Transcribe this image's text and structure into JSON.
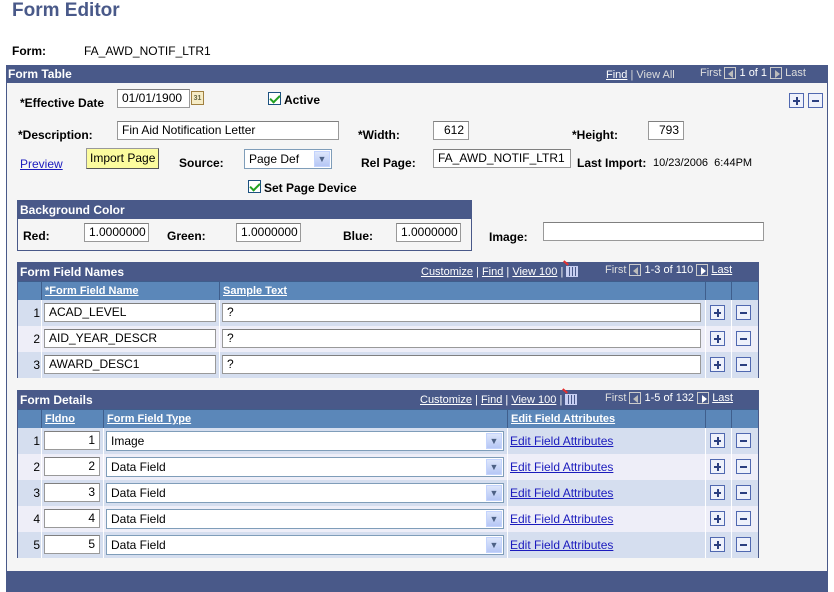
{
  "page": {
    "title": "Form Editor",
    "form_label": "Form:",
    "form_value": "FA_AWD_NOTIF_LTR1"
  },
  "form_table": {
    "header": "Form Table",
    "nav": {
      "find": "Find",
      "view_all": "View All",
      "first": "First",
      "count": "1 of 1",
      "last": "Last"
    },
    "effective_date_label": "*Effective Date",
    "effective_date": "01/01/1900",
    "active_label": "Active",
    "active_checked": true,
    "description_label": "*Description:",
    "description": "Fin Aid Notification Letter",
    "width_label": "*Width:",
    "width": "612",
    "height_label": "*Height:",
    "height": "793",
    "preview_link": "Preview",
    "import_page_button": "Import Page",
    "source_label": "Source:",
    "source_value": "Page Def",
    "rel_page_label": "Rel Page:",
    "rel_page": "FA_AWD_NOTIF_LTR1",
    "last_import_label": "Last Import:",
    "last_import": "10/23/2006  6:44PM",
    "set_page_device_label": "Set Page Device",
    "set_page_device_checked": true,
    "image_label": "Image:",
    "image_value": ""
  },
  "background_color": {
    "header": "Background Color",
    "red_label": "Red:",
    "red": "1.0000000",
    "green_label": "Green:",
    "green": "1.0000000",
    "blue_label": "Blue:",
    "blue": "1.0000000"
  },
  "form_field_names": {
    "header": "Form Field Names",
    "nav": {
      "customize": "Customize",
      "find": "Find",
      "view": "View 100",
      "first": "First",
      "count": "1-3 of 110",
      "last": "Last"
    },
    "columns": [
      "*Form Field Name",
      "Sample Text"
    ],
    "rows": [
      {
        "num": "1",
        "name": "ACAD_LEVEL",
        "sample": "?"
      },
      {
        "num": "2",
        "name": "AID_YEAR_DESCR",
        "sample": "?"
      },
      {
        "num": "3",
        "name": "AWARD_DESC1",
        "sample": "?"
      }
    ]
  },
  "form_details": {
    "header": "Form Details",
    "nav": {
      "customize": "Customize",
      "find": "Find",
      "view": "View 100",
      "first": "First",
      "count": "1-5 of 132",
      "last": "Last"
    },
    "columns": [
      "Fldno",
      "Form Field Type",
      "Edit Field Attributes"
    ],
    "rows": [
      {
        "num": "1",
        "fldno": "1",
        "type": "Image",
        "link": "Edit Field Attributes"
      },
      {
        "num": "2",
        "fldno": "2",
        "type": "Data Field",
        "link": "Edit Field Attributes"
      },
      {
        "num": "3",
        "fldno": "3",
        "type": "Data Field",
        "link": "Edit Field Attributes"
      },
      {
        "num": "4",
        "fldno": "4",
        "type": "Data Field",
        "link": "Edit Field Attributes"
      },
      {
        "num": "5",
        "fldno": "5",
        "type": "Data Field",
        "link": "Edit Field Attributes"
      }
    ]
  },
  "colors": {
    "header_bg": "#495989",
    "column_header_bg": "#5b87b9",
    "row_odd": "#d5deef",
    "row_even": "#eeeef8",
    "link": "#1b1bbd",
    "import_button": "#fcfc9e"
  }
}
